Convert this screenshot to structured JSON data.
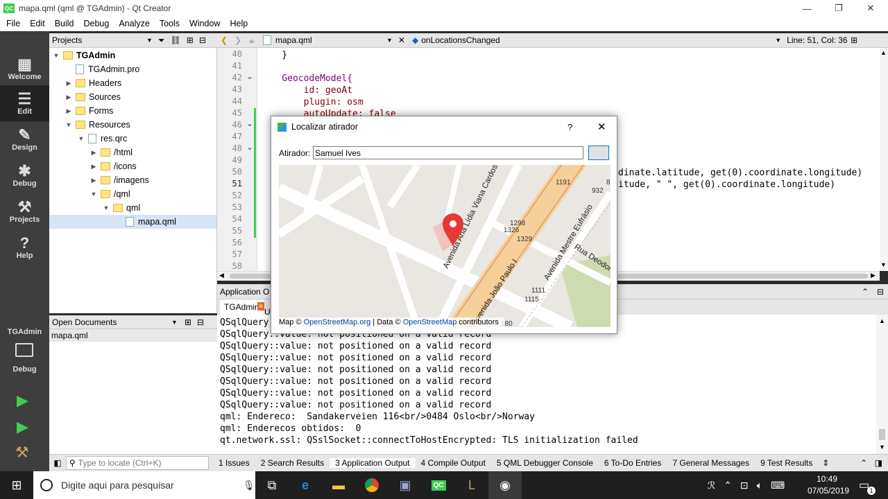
{
  "window": {
    "title": "mapa.qml (qml @ TGAdmin) - Qt Creator",
    "app_icon": "QC"
  },
  "menu": [
    "File",
    "Edit",
    "Build",
    "Debug",
    "Analyze",
    "Tools",
    "Window",
    "Help"
  ],
  "modes": [
    {
      "label": "Welcome",
      "icon": "grid-icon"
    },
    {
      "label": "Edit",
      "icon": "edit-icon"
    },
    {
      "label": "Design",
      "icon": "pencil-icon"
    },
    {
      "label": "Debug",
      "icon": "bug-icon"
    },
    {
      "label": "Projects",
      "icon": "wrench-icon"
    },
    {
      "label": "Help",
      "icon": "help-icon"
    }
  ],
  "kit": {
    "project": "TGAdmin",
    "config": "Debug"
  },
  "projects": {
    "header": "Projects",
    "tree": [
      {
        "label": "TGAdmin",
        "type": "project",
        "depth": 0,
        "arrow": "down"
      },
      {
        "label": "TGAdmin.pro",
        "type": "file",
        "depth": 1,
        "arrow": ""
      },
      {
        "label": "Headers",
        "type": "folder",
        "depth": 1,
        "arrow": "right"
      },
      {
        "label": "Sources",
        "type": "folder",
        "depth": 1,
        "arrow": "right"
      },
      {
        "label": "Forms",
        "type": "folder",
        "depth": 1,
        "arrow": "right"
      },
      {
        "label": "Resources",
        "type": "folder",
        "depth": 1,
        "arrow": "down"
      },
      {
        "label": "res.qrc",
        "type": "file",
        "depth": 2,
        "arrow": "down"
      },
      {
        "label": "/html",
        "type": "folder",
        "depth": 3,
        "arrow": "right"
      },
      {
        "label": "/icons",
        "type": "folder",
        "depth": 3,
        "arrow": "right"
      },
      {
        "label": "/imagens",
        "type": "folder",
        "depth": 3,
        "arrow": "right"
      },
      {
        "label": "/qml",
        "type": "folder",
        "depth": 3,
        "arrow": "down"
      },
      {
        "label": "qml",
        "type": "folder",
        "depth": 4,
        "arrow": "down"
      },
      {
        "label": "mapa.qml",
        "type": "file",
        "depth": 5,
        "arrow": "",
        "selected": true
      }
    ]
  },
  "open_documents": {
    "header": "Open Documents",
    "items": [
      "mapa.qml"
    ]
  },
  "editor": {
    "file": "mapa.qml",
    "symbol": "onLocationsChanged",
    "position": "Line: 51, Col: 36",
    "lines": [
      {
        "n": "40",
        "text": "    }"
      },
      {
        "n": "41",
        "text": ""
      },
      {
        "n": "42",
        "text": "    GeocodeModel{"
      },
      {
        "n": "43",
        "text": "        id: geoAt"
      },
      {
        "n": "44",
        "text": "        plugin: osm"
      },
      {
        "n": "45",
        "text": "        autoUpdate: false"
      },
      {
        "n": "46",
        "text": ""
      },
      {
        "n": "47",
        "text": ""
      },
      {
        "n": "48",
        "text": ""
      },
      {
        "n": "49",
        "text": ""
      },
      {
        "n": "50",
        "text": "dinate.latitude, get(0).coordinate.longitude)"
      },
      {
        "n": "51",
        "text": "itude, \" \", get(0).coordinate.longitude)"
      },
      {
        "n": "52",
        "text": ""
      },
      {
        "n": "53",
        "text": ""
      },
      {
        "n": "54",
        "text": ""
      },
      {
        "n": "55",
        "text": ""
      },
      {
        "n": "56",
        "text": ""
      },
      {
        "n": "57",
        "text": ""
      },
      {
        "n": "58",
        "text": ""
      }
    ]
  },
  "output": {
    "header": "Application O",
    "tab": "TGAdmin",
    "partial_text": "Us",
    "lines": [
      "QSqlQuery",
      "QSqlQuery::value: not positioned on a valid record",
      "QSqlQuery::value: not positioned on a valid record",
      "QSqlQuery::value: not positioned on a valid record",
      "QSqlQuery::value: not positioned on a valid record",
      "QSqlQuery::value: not positioned on a valid record",
      "QSqlQuery::value: not positioned on a valid record",
      "QSqlQuery::value: not positioned on a valid record",
      "qml: Endereco:  Sandakerveien 116<br/>0484 Oslo<br/>Norway",
      "qml: Enderecos obtidos:  0",
      "qt.network.ssl: QSslSocket::connectToHostEncrypted: TLS initialization failed"
    ]
  },
  "locator": {
    "placeholder": "Type to locate (Ctrl+K)"
  },
  "bottom_tabs": [
    "1  Issues",
    "2  Search Results",
    "3  Application Output",
    "4  Compile Output",
    "5  QML Debugger Console",
    "6  To-Do Entries",
    "7  General Messages",
    "9  Test Results"
  ],
  "dialog": {
    "title": "Localizar atirador",
    "help": "?",
    "close": "✕",
    "field_label": "Atirador:",
    "field_value": "Samuel Ives",
    "attribution": {
      "prefix": "Map © ",
      "link1": "OpenStreetMap.org",
      "middle": " | Data © ",
      "link2": "OpenStreetMap",
      "suffix": " contributors"
    },
    "map_labels": {
      "street1": "Avenida Ana Lídia Viana Cardoso",
      "street2": "Avenida João Paulo I",
      "street3": "Avenida Mestre Eufrásio",
      "street4": "Rua Deodoro",
      "n1191": "1191",
      "n932": "932",
      "n8": "8",
      "n1298": "1298",
      "n1326": "1326",
      "n1329": "1329",
      "n1111": "1111",
      "n1115": "1115",
      "n180": "180"
    }
  },
  "taskbar": {
    "search_placeholder": "Digite aqui para pesquisar",
    "time": "10:49",
    "date": "07/05/2019",
    "notif": "1"
  },
  "colors": {
    "accent": "#41cd52",
    "selection": "#d6e4f5",
    "road_major": "#f7cf9b",
    "marker": "#e53935"
  }
}
